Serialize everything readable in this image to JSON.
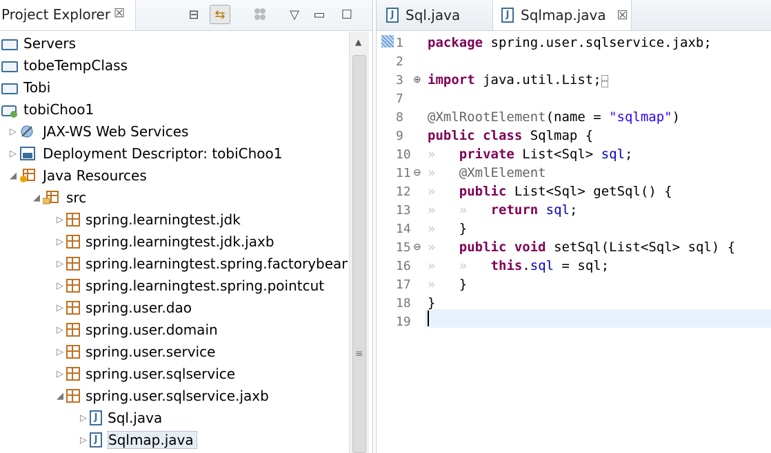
{
  "explorer": {
    "title": "Project Explorer",
    "close": "☒",
    "toolbar": {
      "collapse": "⊟",
      "link": "⇆",
      "view_menu": "▽",
      "minimize": "▭",
      "maximize": "☐"
    },
    "items": [
      {
        "label": "Servers",
        "arrow": "",
        "icon": "folder-icon"
      },
      {
        "label": "tobeTempClass",
        "arrow": "",
        "icon": "folder-icon"
      },
      {
        "label": "Tobi",
        "arrow": "",
        "icon": "folder-icon"
      },
      {
        "label": "tobiChoo1",
        "arrow": "",
        "icon": "project-icon"
      },
      {
        "label": "JAX-WS Web Services",
        "arrow": "▷",
        "icon": "webservice-icon"
      },
      {
        "label": "Deployment Descriptor: tobiChoo1",
        "arrow": "▷",
        "icon": "descriptor-icon"
      },
      {
        "label": "Java Resources",
        "arrow": "◢",
        "icon": "java-resources-icon"
      },
      {
        "label": "src",
        "arrow": "◢",
        "icon": "source-folder-icon"
      },
      {
        "label": "spring.learningtest.jdk",
        "arrow": "▷",
        "icon": "package-icon"
      },
      {
        "label": "spring.learningtest.jdk.jaxb",
        "arrow": "▷",
        "icon": "package-icon"
      },
      {
        "label": "spring.learningtest.spring.factorybean",
        "arrow": "▷",
        "icon": "package-icon"
      },
      {
        "label": "spring.learningtest.spring.pointcut",
        "arrow": "▷",
        "icon": "package-icon"
      },
      {
        "label": "spring.user.dao",
        "arrow": "▷",
        "icon": "package-icon"
      },
      {
        "label": "spring.user.domain",
        "arrow": "▷",
        "icon": "package-icon"
      },
      {
        "label": "spring.user.service",
        "arrow": "▷",
        "icon": "package-icon"
      },
      {
        "label": "spring.user.sqlservice",
        "arrow": "▷",
        "icon": "package-icon"
      },
      {
        "label": "spring.user.sqlservice.jaxb",
        "arrow": "◢",
        "icon": "package-icon"
      },
      {
        "label": "Sql.java",
        "arrow": "▷",
        "icon": "java-file-icon"
      },
      {
        "label": "Sqlmap.java",
        "arrow": "▷",
        "icon": "java-file-icon"
      }
    ]
  },
  "editor": {
    "tabs": [
      {
        "label": "Sql.java",
        "icon_text": "J"
      },
      {
        "label": "Sqlmap.java",
        "icon_text": "J",
        "close": "☒"
      }
    ],
    "lines": [
      {
        "n": "1",
        "fold": ""
      },
      {
        "n": "2",
        "fold": ""
      },
      {
        "n": "3",
        "fold": "⊕"
      },
      {
        "n": "7",
        "fold": ""
      },
      {
        "n": "8",
        "fold": ""
      },
      {
        "n": "9",
        "fold": ""
      },
      {
        "n": "10",
        "fold": ""
      },
      {
        "n": "11",
        "fold": "⊖"
      },
      {
        "n": "12",
        "fold": ""
      },
      {
        "n": "13",
        "fold": ""
      },
      {
        "n": "14",
        "fold": ""
      },
      {
        "n": "15",
        "fold": "⊖"
      },
      {
        "n": "16",
        "fold": ""
      },
      {
        "n": "17",
        "fold": ""
      },
      {
        "n": "18",
        "fold": ""
      },
      {
        "n": "19",
        "fold": ""
      }
    ],
    "code": {
      "l1_kw": "package",
      "l1_rest": " spring.user.sqlservice.jaxb;",
      "l3_kw": "import",
      "l3_rest": " java.util.List;",
      "l3_fold": "⋯",
      "l8_ann": "@XmlRootElement",
      "l8_a": "(name = ",
      "l8_str": "\"sqlmap\"",
      "l8_b": ")",
      "l9_kw": "public class",
      "l9_rest": " Sqlmap {",
      "l10_kw": "private",
      "l10_a": " List<Sql> ",
      "l10_fld": "sql",
      "l10_b": ";",
      "l11_ann": "@XmlElement",
      "l12_kw": "public",
      "l12_rest": " List<Sql> getSql() {",
      "l13_kw": "return",
      "l13_fld": " sql",
      "l13_b": ";",
      "l14": "}",
      "l15_kw": "public void",
      "l15_rest": " setSql(List<Sql> sql) {",
      "l16_kw": "this",
      "l16_a": ".",
      "l16_fld": "sql",
      "l16_b": " = sql;",
      "l17": "}",
      "l18": "}",
      "ws": "»"
    }
  }
}
